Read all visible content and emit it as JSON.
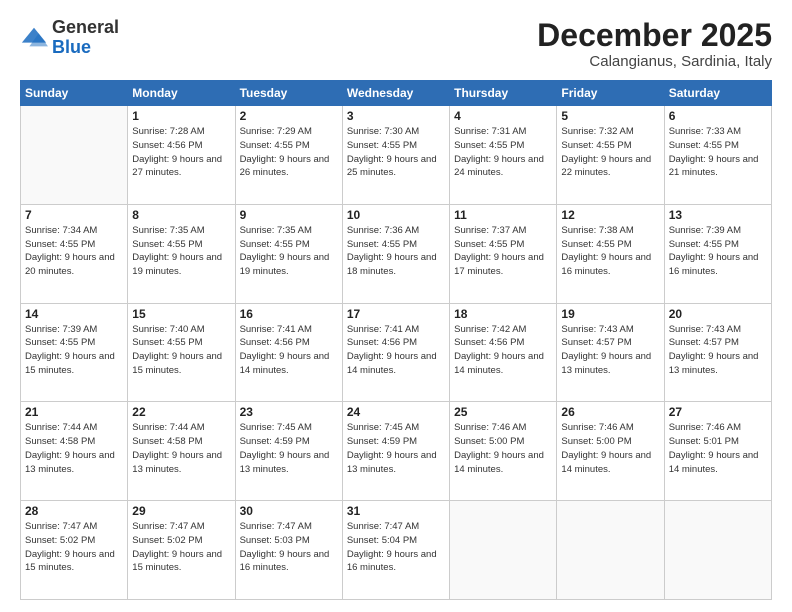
{
  "header": {
    "logo_general": "General",
    "logo_blue": "Blue",
    "month_title": "December 2025",
    "location": "Calangianus, Sardinia, Italy"
  },
  "days_of_week": [
    "Sunday",
    "Monday",
    "Tuesday",
    "Wednesday",
    "Thursday",
    "Friday",
    "Saturday"
  ],
  "weeks": [
    [
      {
        "day": "",
        "sunrise": "",
        "sunset": "",
        "daylight": ""
      },
      {
        "day": "1",
        "sunrise": "Sunrise: 7:28 AM",
        "sunset": "Sunset: 4:56 PM",
        "daylight": "Daylight: 9 hours and 27 minutes."
      },
      {
        "day": "2",
        "sunrise": "Sunrise: 7:29 AM",
        "sunset": "Sunset: 4:55 PM",
        "daylight": "Daylight: 9 hours and 26 minutes."
      },
      {
        "day": "3",
        "sunrise": "Sunrise: 7:30 AM",
        "sunset": "Sunset: 4:55 PM",
        "daylight": "Daylight: 9 hours and 25 minutes."
      },
      {
        "day": "4",
        "sunrise": "Sunrise: 7:31 AM",
        "sunset": "Sunset: 4:55 PM",
        "daylight": "Daylight: 9 hours and 24 minutes."
      },
      {
        "day": "5",
        "sunrise": "Sunrise: 7:32 AM",
        "sunset": "Sunset: 4:55 PM",
        "daylight": "Daylight: 9 hours and 22 minutes."
      },
      {
        "day": "6",
        "sunrise": "Sunrise: 7:33 AM",
        "sunset": "Sunset: 4:55 PM",
        "daylight": "Daylight: 9 hours and 21 minutes."
      }
    ],
    [
      {
        "day": "7",
        "sunrise": "Sunrise: 7:34 AM",
        "sunset": "Sunset: 4:55 PM",
        "daylight": "Daylight: 9 hours and 20 minutes."
      },
      {
        "day": "8",
        "sunrise": "Sunrise: 7:35 AM",
        "sunset": "Sunset: 4:55 PM",
        "daylight": "Daylight: 9 hours and 19 minutes."
      },
      {
        "day": "9",
        "sunrise": "Sunrise: 7:35 AM",
        "sunset": "Sunset: 4:55 PM",
        "daylight": "Daylight: 9 hours and 19 minutes."
      },
      {
        "day": "10",
        "sunrise": "Sunrise: 7:36 AM",
        "sunset": "Sunset: 4:55 PM",
        "daylight": "Daylight: 9 hours and 18 minutes."
      },
      {
        "day": "11",
        "sunrise": "Sunrise: 7:37 AM",
        "sunset": "Sunset: 4:55 PM",
        "daylight": "Daylight: 9 hours and 17 minutes."
      },
      {
        "day": "12",
        "sunrise": "Sunrise: 7:38 AM",
        "sunset": "Sunset: 4:55 PM",
        "daylight": "Daylight: 9 hours and 16 minutes."
      },
      {
        "day": "13",
        "sunrise": "Sunrise: 7:39 AM",
        "sunset": "Sunset: 4:55 PM",
        "daylight": "Daylight: 9 hours and 16 minutes."
      }
    ],
    [
      {
        "day": "14",
        "sunrise": "Sunrise: 7:39 AM",
        "sunset": "Sunset: 4:55 PM",
        "daylight": "Daylight: 9 hours and 15 minutes."
      },
      {
        "day": "15",
        "sunrise": "Sunrise: 7:40 AM",
        "sunset": "Sunset: 4:55 PM",
        "daylight": "Daylight: 9 hours and 15 minutes."
      },
      {
        "day": "16",
        "sunrise": "Sunrise: 7:41 AM",
        "sunset": "Sunset: 4:56 PM",
        "daylight": "Daylight: 9 hours and 14 minutes."
      },
      {
        "day": "17",
        "sunrise": "Sunrise: 7:41 AM",
        "sunset": "Sunset: 4:56 PM",
        "daylight": "Daylight: 9 hours and 14 minutes."
      },
      {
        "day": "18",
        "sunrise": "Sunrise: 7:42 AM",
        "sunset": "Sunset: 4:56 PM",
        "daylight": "Daylight: 9 hours and 14 minutes."
      },
      {
        "day": "19",
        "sunrise": "Sunrise: 7:43 AM",
        "sunset": "Sunset: 4:57 PM",
        "daylight": "Daylight: 9 hours and 13 minutes."
      },
      {
        "day": "20",
        "sunrise": "Sunrise: 7:43 AM",
        "sunset": "Sunset: 4:57 PM",
        "daylight": "Daylight: 9 hours and 13 minutes."
      }
    ],
    [
      {
        "day": "21",
        "sunrise": "Sunrise: 7:44 AM",
        "sunset": "Sunset: 4:58 PM",
        "daylight": "Daylight: 9 hours and 13 minutes."
      },
      {
        "day": "22",
        "sunrise": "Sunrise: 7:44 AM",
        "sunset": "Sunset: 4:58 PM",
        "daylight": "Daylight: 9 hours and 13 minutes."
      },
      {
        "day": "23",
        "sunrise": "Sunrise: 7:45 AM",
        "sunset": "Sunset: 4:59 PM",
        "daylight": "Daylight: 9 hours and 13 minutes."
      },
      {
        "day": "24",
        "sunrise": "Sunrise: 7:45 AM",
        "sunset": "Sunset: 4:59 PM",
        "daylight": "Daylight: 9 hours and 13 minutes."
      },
      {
        "day": "25",
        "sunrise": "Sunrise: 7:46 AM",
        "sunset": "Sunset: 5:00 PM",
        "daylight": "Daylight: 9 hours and 14 minutes."
      },
      {
        "day": "26",
        "sunrise": "Sunrise: 7:46 AM",
        "sunset": "Sunset: 5:00 PM",
        "daylight": "Daylight: 9 hours and 14 minutes."
      },
      {
        "day": "27",
        "sunrise": "Sunrise: 7:46 AM",
        "sunset": "Sunset: 5:01 PM",
        "daylight": "Daylight: 9 hours and 14 minutes."
      }
    ],
    [
      {
        "day": "28",
        "sunrise": "Sunrise: 7:47 AM",
        "sunset": "Sunset: 5:02 PM",
        "daylight": "Daylight: 9 hours and 15 minutes."
      },
      {
        "day": "29",
        "sunrise": "Sunrise: 7:47 AM",
        "sunset": "Sunset: 5:02 PM",
        "daylight": "Daylight: 9 hours and 15 minutes."
      },
      {
        "day": "30",
        "sunrise": "Sunrise: 7:47 AM",
        "sunset": "Sunset: 5:03 PM",
        "daylight": "Daylight: 9 hours and 16 minutes."
      },
      {
        "day": "31",
        "sunrise": "Sunrise: 7:47 AM",
        "sunset": "Sunset: 5:04 PM",
        "daylight": "Daylight: 9 hours and 16 minutes."
      },
      {
        "day": "",
        "sunrise": "",
        "sunset": "",
        "daylight": ""
      },
      {
        "day": "",
        "sunrise": "",
        "sunset": "",
        "daylight": ""
      },
      {
        "day": "",
        "sunrise": "",
        "sunset": "",
        "daylight": ""
      }
    ]
  ]
}
